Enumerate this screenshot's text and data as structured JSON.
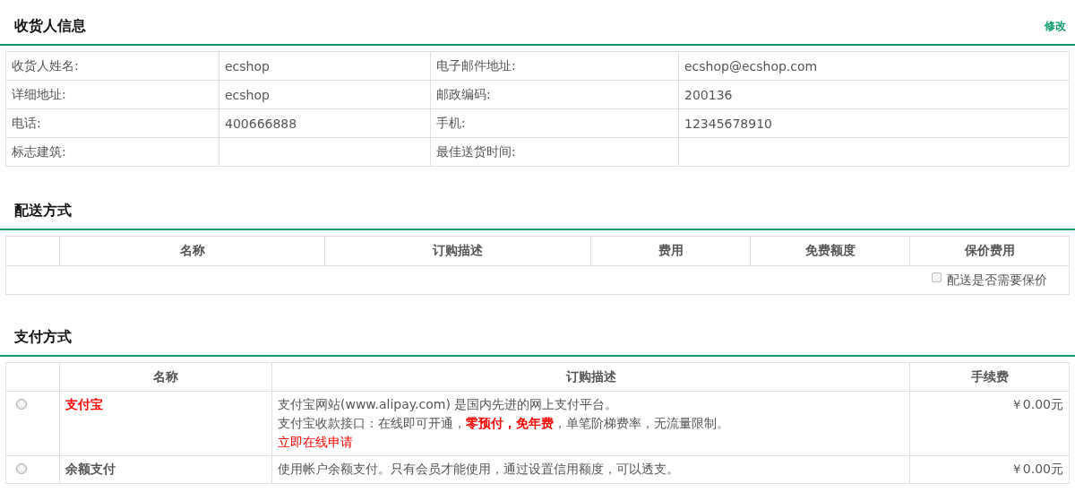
{
  "consignee": {
    "title": "收货人信息",
    "action": "修改",
    "fields": [
      {
        "label": "收货人姓名:",
        "value": "ecshop"
      },
      {
        "label": "电子邮件地址:",
        "value": "ecshop@ecshop.com"
      },
      {
        "label": "详细地址:",
        "value": "ecshop"
      },
      {
        "label": "邮政编码:",
        "value": "200136"
      },
      {
        "label": "电话:",
        "value": "400666888"
      },
      {
        "label": "手机:",
        "value": "12345678910"
      },
      {
        "label": "标志建筑:"
      },
      {
        "label": "最佳送货时间:"
      }
    ]
  },
  "shipping": {
    "title": "配送方式",
    "columns": [
      "名称",
      "订购描述",
      "费用",
      "免费额度",
      "保价费用"
    ],
    "insure": {
      "label": "配送是否需要保价",
      "checked": false
    }
  },
  "payment": {
    "title": "支付方式",
    "columns": [
      "名称",
      "订购描述",
      "手续费"
    ],
    "methods": [
      {
        "name": "支付宝",
        "highlighted": true,
        "selected": false,
        "fee": "￥0.00元",
        "description": [
          {
            "kind": "text",
            "text": "支付宝网站(www.alipay.com) 是国内先进的网上支付平台。"
          },
          {
            "kind": "text",
            "text": "支付宝收款接口：在线即可开通，**零预付，免年费**，单笔阶梯费率，无流量限制。"
          },
          {
            "kind": "link",
            "text": "立即在线申请"
          }
        ]
      },
      {
        "name": "余额支付",
        "highlighted": false,
        "selected": false,
        "fee": "￥0.00元",
        "description": [
          {
            "kind": "text",
            "text": "使用帐户余额支付。只有会员才能使用，通过设置信用额度，可以透支。"
          }
        ]
      }
    ]
  }
}
